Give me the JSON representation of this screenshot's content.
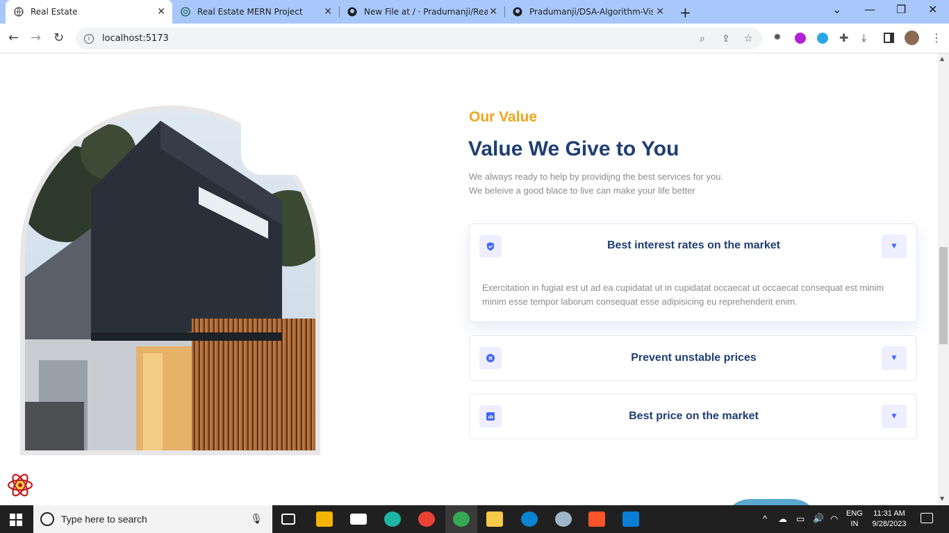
{
  "browser": {
    "tabs": [
      {
        "title": "Real Estate",
        "active": true,
        "icon": "globe-icon"
      },
      {
        "title": "Real Estate MERN Project",
        "active": false,
        "icon": "chatgpt-icon"
      },
      {
        "title": "New File at / · Pradumanji/Real-E",
        "active": false,
        "icon": "github-icon"
      },
      {
        "title": "Pradumanji/DSA-Algorithm-Visu",
        "active": false,
        "icon": "github-icon"
      }
    ],
    "url": "localhost:5173"
  },
  "section": {
    "eyebrow": "Our Value",
    "title": "Value We Give to You",
    "description_line1": "We always ready to help by providijng the best services for you.",
    "description_line2": "We beleive a good blace to live can make your life better"
  },
  "accordion": [
    {
      "title": "Best interest rates on the market",
      "icon": "shield-check-icon",
      "expanded": true,
      "body": "Exercitation in fugiat est ut ad ea cupidatat ut in cupidatat occaecat ut occaecat consequat est minim minim esse tempor laborum consequat esse adipisicing eu reprehenderit enim."
    },
    {
      "title": "Prevent unstable prices",
      "icon": "x-circle-icon",
      "expanded": false,
      "body": ""
    },
    {
      "title": "Best price on the market",
      "icon": "chart-icon",
      "expanded": false,
      "body": ""
    }
  ],
  "taskbar": {
    "search_placeholder": "Type here to search",
    "lang_line1": "ENG",
    "lang_line2": "IN",
    "time": "11:31 AM",
    "date": "9/28/2023"
  },
  "colors": {
    "accent_orange": "#f3a31b",
    "title_blue": "#1f3e72",
    "icon_blue": "#4066ff",
    "icon_bg": "#eeeeff"
  }
}
